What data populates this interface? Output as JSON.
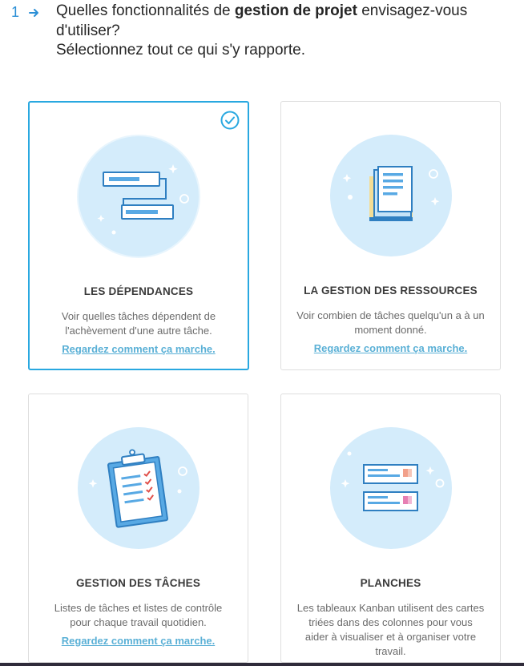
{
  "question": {
    "number": "1",
    "text_before": "Quelles fonctionnalités de ",
    "text_bold": "gestion de projet",
    "text_after": " envisagez-vous d'utiliser?",
    "line2": "Sélectionnez tout ce qui s'y rapporte."
  },
  "cards": [
    {
      "title": "LES DÉPENDANCES",
      "description": "Voir quelles tâches dépendent de l'achèvement d'une autre tâche.",
      "link": "Regardez comment ça marche.",
      "selected": true,
      "icon": "dependencies-icon"
    },
    {
      "title": "LA GESTION DES RESSOURCES",
      "description": "Voir combien de tâches quelqu'un a à un moment donné.",
      "link": "Regardez comment ça marche.",
      "selected": false,
      "icon": "resources-icon"
    },
    {
      "title": "GESTION DES TÂCHES",
      "description": "Listes de tâches et listes de contrôle pour chaque travail quotidien.",
      "link": "Regardez comment ça marche.",
      "selected": false,
      "icon": "clipboard-checklist-icon"
    },
    {
      "title": "PLANCHES",
      "description": "Les tableaux Kanban utilisent des cartes triées dans des colonnes pour vous aider à visualiser et à organiser votre travail.",
      "selected": false,
      "icon": "kanban-board-icon"
    }
  ],
  "colors": {
    "accent": "#29a8e0",
    "circle_fill": "#d4ecfb",
    "link": "#5ab0d6"
  }
}
